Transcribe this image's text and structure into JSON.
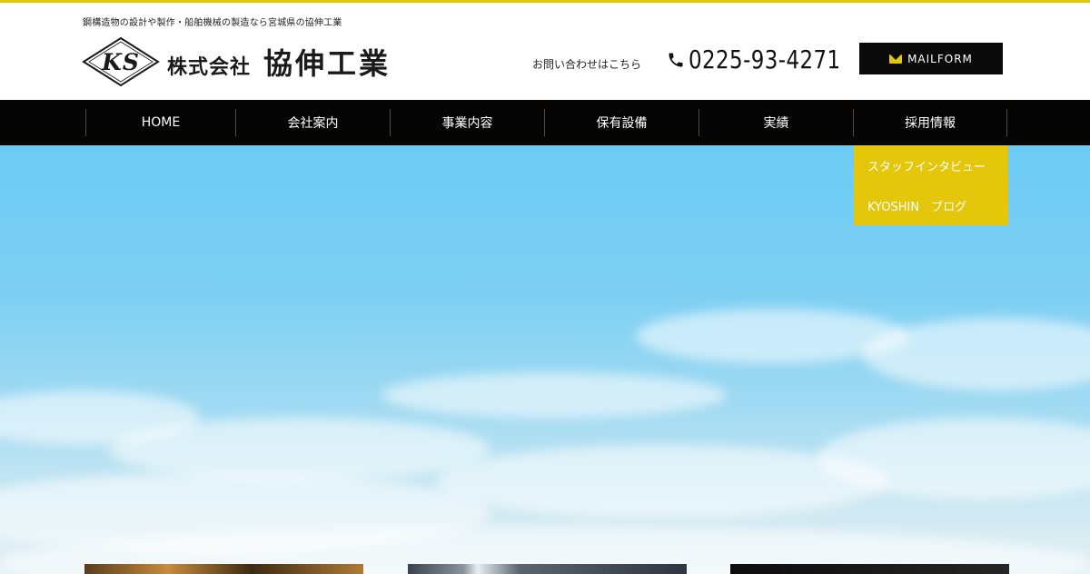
{
  "header": {
    "tagline": "鋼構造物の設計や製作・船舶機械の製造なら宮城県の協伸工業",
    "logo_mark": "KS",
    "logo_prefix": "株式会社",
    "logo_name": "協伸工業",
    "contact_label": "お問い合わせはこちら",
    "phone": "0225-93-4271",
    "mailform_label": "MAILFORM"
  },
  "nav": {
    "items": [
      {
        "label": "HOME"
      },
      {
        "label": "会社案内"
      },
      {
        "label": "事業内容"
      },
      {
        "label": "保有設備"
      },
      {
        "label": "実績"
      },
      {
        "label": "採用情報"
      }
    ],
    "dropdown": [
      {
        "label": "スタッフインタビュー"
      },
      {
        "label": "KYOSHIN　ブログ"
      }
    ]
  },
  "colors": {
    "accent": "#e4c60b",
    "nav_bg": "#050505",
    "sky": "#6ccbf4"
  },
  "icons": {
    "phone": "phone-icon",
    "mail": "mail-icon",
    "logo": "ks-diamond-logo"
  }
}
